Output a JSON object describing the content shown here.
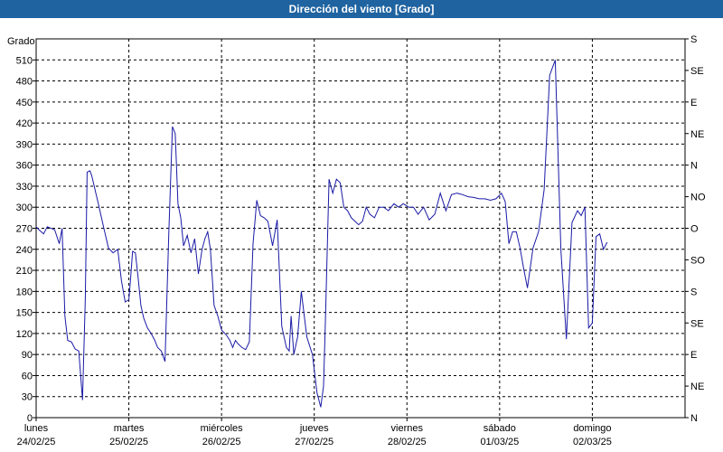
{
  "header": {
    "title": "Dirección del viento [Grado]"
  },
  "chart_data": {
    "type": "line",
    "ylabel": "Grado",
    "ylim": [
      0,
      540
    ],
    "yticks": [
      0,
      30,
      60,
      90,
      120,
      150,
      180,
      210,
      240,
      270,
      300,
      330,
      360,
      390,
      420,
      450,
      480,
      510
    ],
    "y2_labels": [
      {
        "value": 0,
        "label": "N"
      },
      {
        "value": 45,
        "label": "NE"
      },
      {
        "value": 90,
        "label": "E"
      },
      {
        "value": 135,
        "label": "SE"
      },
      {
        "value": 180,
        "label": "S"
      },
      {
        "value": 225,
        "label": "SO"
      },
      {
        "value": 270,
        "label": "O"
      },
      {
        "value": 315,
        "label": "NO"
      },
      {
        "value": 360,
        "label": "N"
      },
      {
        "value": 405,
        "label": "NE"
      },
      {
        "value": 450,
        "label": "E"
      },
      {
        "value": 495,
        "label": "SE"
      },
      {
        "value": 540,
        "label": "S"
      }
    ],
    "xlim": [
      0,
      7
    ],
    "days": [
      {
        "day": "lunes",
        "date": "24/02/25"
      },
      {
        "day": "martes",
        "date": "25/02/25"
      },
      {
        "day": "miércoles",
        "date": "26/02/25"
      },
      {
        "day": "jueves",
        "date": "27/02/25"
      },
      {
        "day": "viernes",
        "date": "28/02/25"
      },
      {
        "day": "sábado",
        "date": "01/03/25"
      },
      {
        "day": "domingo",
        "date": "02/03/25"
      }
    ],
    "grid": true,
    "series_color": "#1a1aa6",
    "x": [
      0.0,
      0.03,
      0.08,
      0.12,
      0.2,
      0.25,
      0.28,
      0.31,
      0.34,
      0.38,
      0.42,
      0.46,
      0.5,
      0.53,
      0.55,
      0.58,
      0.6,
      0.63,
      0.68,
      0.73,
      0.78,
      0.83,
      0.88,
      0.92,
      0.96,
      1.0,
      1.02,
      1.04,
      1.07,
      1.1,
      1.13,
      1.16,
      1.2,
      1.24,
      1.28,
      1.31,
      1.35,
      1.39,
      1.43,
      1.47,
      1.5,
      1.53,
      1.56,
      1.59,
      1.63,
      1.67,
      1.71,
      1.75,
      1.79,
      1.82,
      1.85,
      1.88,
      1.92,
      1.96,
      2.0,
      2.05,
      2.09,
      2.12,
      2.15,
      2.18,
      2.22,
      2.26,
      2.3,
      2.34,
      2.38,
      2.42,
      2.46,
      2.5,
      2.55,
      2.6,
      2.65,
      2.7,
      2.73,
      2.75,
      2.78,
      2.82,
      2.86,
      2.92,
      2.98,
      3.03,
      3.07,
      3.1,
      3.12,
      3.16,
      3.2,
      3.24,
      3.28,
      3.32,
      3.36,
      3.4,
      3.44,
      3.48,
      3.52,
      3.56,
      3.6,
      3.65,
      3.7,
      3.75,
      3.8,
      3.86,
      3.91,
      3.96,
      4.02,
      4.07,
      4.12,
      4.18,
      4.24,
      4.3,
      4.36,
      4.42,
      4.48,
      4.54,
      4.6,
      4.66,
      4.72,
      4.78,
      4.84,
      4.9,
      4.96,
      5.02,
      5.06,
      5.1,
      5.14,
      5.18,
      5.22,
      5.26,
      5.3,
      5.36,
      5.42,
      5.48,
      5.54,
      5.6,
      5.66,
      5.72,
      5.78,
      5.84,
      5.88,
      5.92,
      5.96,
      6.0,
      6.04,
      6.08,
      6.12,
      6.16,
      6.2,
      6.24,
      6.28,
      6.32,
      6.36,
      6.4,
      6.44,
      6.48,
      6.52,
      6.55,
      6.58,
      6.62,
      6.66,
      6.7,
      6.72,
      6.75,
      6.79,
      6.82,
      6.86,
      6.9,
      6.94,
      7.0
    ],
    "values": [
      272,
      268,
      262,
      272,
      268,
      248,
      270,
      145,
      110,
      108,
      98,
      95,
      25,
      170,
      350,
      352,
      345,
      328,
      300,
      270,
      242,
      235,
      240,
      195,
      165,
      168,
      200,
      237,
      235,
      200,
      160,
      142,
      128,
      120,
      110,
      100,
      95,
      80,
      260,
      415,
      405,
      305,
      285,
      245,
      260,
      235,
      255,
      205,
      240,
      255,
      265,
      240,
      160,
      145,
      125,
      118,
      110,
      100,
      110,
      105,
      100,
      97,
      108,
      248,
      310,
      288,
      285,
      280,
      245,
      282,
      130,
      100,
      95,
      145,
      90,
      115,
      180,
      115,
      90,
      35,
      15,
      45,
      135,
      340,
      320,
      340,
      335,
      300,
      295,
      285,
      280,
      275,
      280,
      300,
      290,
      285,
      300,
      300,
      295,
      305,
      300,
      305,
      300,
      300,
      290,
      300,
      282,
      290,
      320,
      295,
      318,
      320,
      318,
      315,
      314,
      312,
      312,
      310,
      312,
      320,
      308,
      248,
      265,
      265,
      242,
      212,
      185,
      242,
      265,
      325,
      488,
      510,
      240,
      112,
      278,
      295,
      288,
      300,
      128,
      135,
      258,
      262,
      240,
      250
    ],
    "sample_note": ""
  }
}
